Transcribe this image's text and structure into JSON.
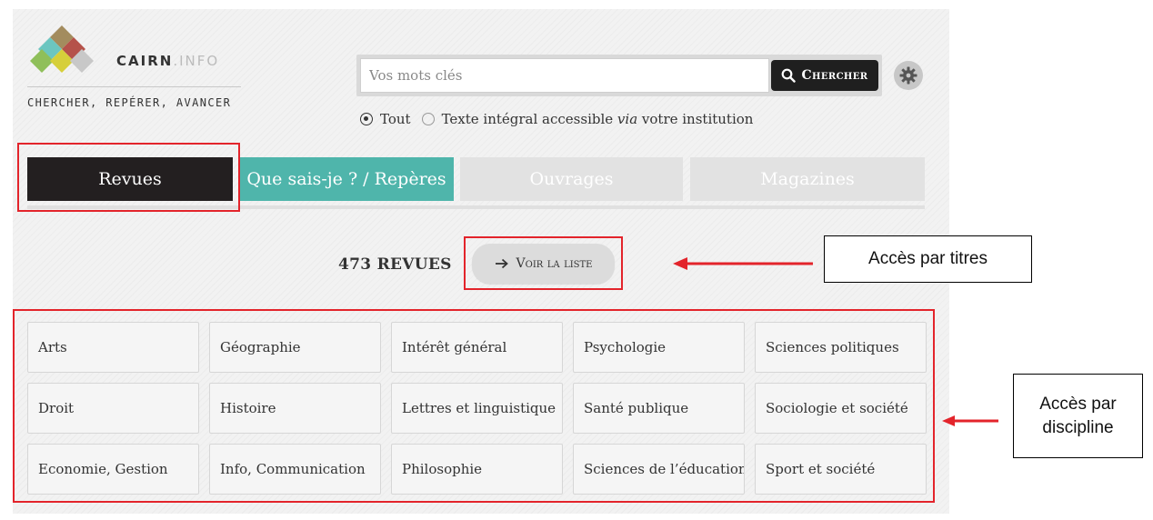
{
  "brand": {
    "name": "CAIRN",
    "separator": ".",
    "suffix": "INFO",
    "tagline": "CHERCHER, REPÉRER, AVANCER"
  },
  "search": {
    "placeholder": "Vos mots clés",
    "button_label": "Chercher",
    "button_icon": "search-icon",
    "settings_icon": "gear-icon",
    "scope_options": [
      {
        "label": "Tout",
        "selected": true
      },
      {
        "label_before": "Texte intégral accessible ",
        "label_italic": "via",
        "label_after": " votre institution",
        "selected": false
      }
    ]
  },
  "tabs": [
    {
      "label": "Revues",
      "active": true,
      "color": "#231f20"
    },
    {
      "label": "Que sais-je ? / Repères",
      "active": false,
      "color": "#4fb5ab"
    },
    {
      "label": "Ouvrages",
      "active": false,
      "color": "#e2e2e2"
    },
    {
      "label": "Magazines",
      "active": false,
      "color": "#e2e2e2"
    }
  ],
  "listing": {
    "count_label": "473 REVUES",
    "voir_button_label": "Voir la liste",
    "voir_button_icon": "arrow-right-icon"
  },
  "disciplines": [
    "Arts",
    "Géographie",
    "Intérêt général",
    "Psychologie",
    "Sciences politiques",
    "Droit",
    "Histoire",
    "Lettres et linguistique",
    "Santé publique",
    "Sociologie et société",
    "Economie, Gestion",
    "Info, Communication",
    "Philosophie",
    "Sciences de l’éducation",
    "Sport et société"
  ],
  "annotations": {
    "titles_label": "Accès par titres",
    "discipline_label_line1": "Accès par",
    "discipline_label_line2": "discipline",
    "highlight_color": "#e3242b"
  }
}
